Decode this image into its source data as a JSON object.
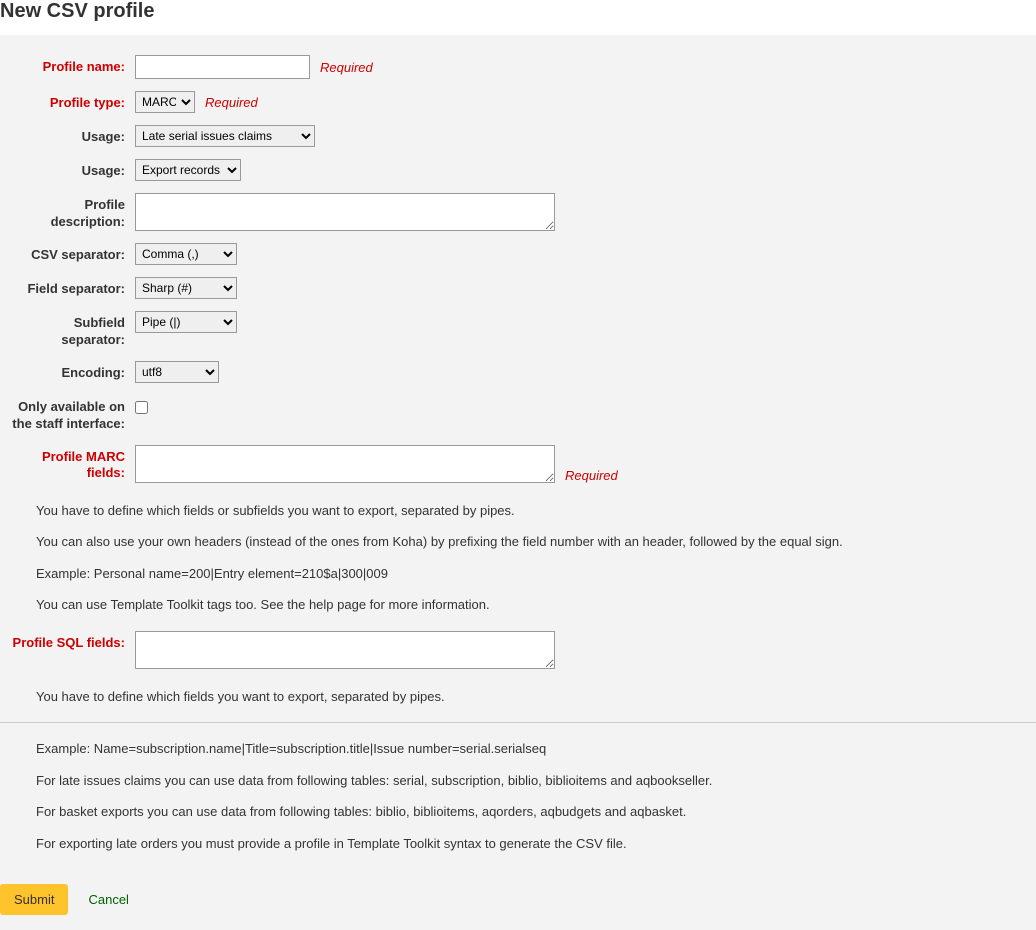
{
  "header": {
    "title": "New CSV profile"
  },
  "labels": {
    "profile_name": "Profile name:",
    "profile_type": "Profile type:",
    "usage1": "Usage:",
    "usage2": "Usage:",
    "profile_description": "Profile description:",
    "csv_separator": "CSV separator:",
    "field_separator": "Field separator:",
    "subfield_separator": "Subfield separator:",
    "encoding": "Encoding:",
    "staff_only": "Only available on the staff interface:",
    "marc_fields": "Profile MARC fields:",
    "sql_fields": "Profile SQL fields:"
  },
  "values": {
    "profile_type": "MARC",
    "usage1": "Late serial issues claims",
    "usage2": "Export records",
    "csv_separator": "Comma (,)",
    "field_separator": "Sharp (#)",
    "subfield_separator": "Pipe (|)",
    "encoding": "utf8"
  },
  "required_text": "Required",
  "help": {
    "marc1": "You have to define which fields or subfields you want to export, separated by pipes.",
    "marc2": "You can also use your own headers (instead of the ones from Koha) by prefixing the field number with an header, followed by the equal sign.",
    "marc3": "Example: Personal name=200|Entry element=210$a|300|009",
    "marc4": "You can use Template Toolkit tags too. See the help page for more information.",
    "sql1": "You have to define which fields you want to export, separated by pipes.",
    "sql2": "Example: Name=subscription.name|Title=subscription.title|Issue number=serial.serialseq",
    "sql3": "For late issues claims you can use data from following tables: serial, subscription, biblio, biblioitems and aqbookseller.",
    "sql4": "For basket exports you can use data from following tables: biblio, biblioitems, aqorders, aqbudgets and aqbasket.",
    "sql5": "For exporting late orders you must provide a profile in Template Toolkit syntax to generate the CSV file."
  },
  "buttons": {
    "submit": "Submit",
    "cancel": "Cancel"
  }
}
